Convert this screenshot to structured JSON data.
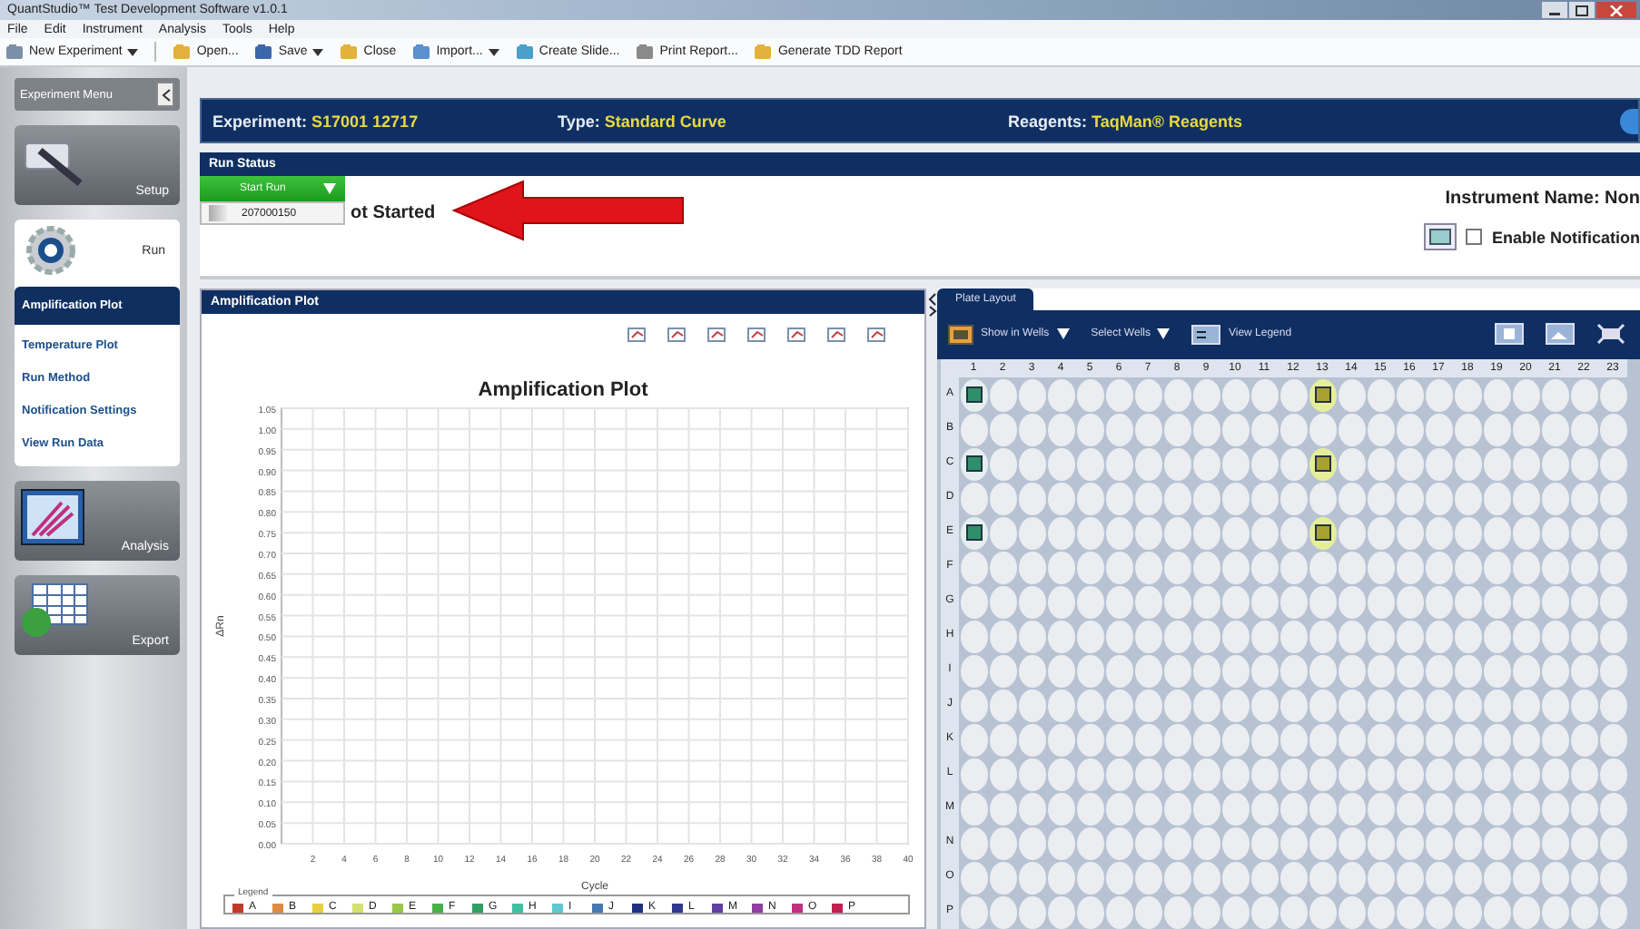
{
  "window": {
    "title": "QuantStudio™ Test Development Software v1.0.1"
  },
  "menu": [
    "File",
    "Edit",
    "Instrument",
    "Analysis",
    "Tools",
    "Help"
  ],
  "toolbar": [
    {
      "label": "New Experiment",
      "dropdown": true,
      "kind": "new"
    },
    {
      "label": "Open...",
      "dropdown": false,
      "kind": "folder"
    },
    {
      "label": "Save",
      "dropdown": true,
      "kind": "save"
    },
    {
      "label": "Close",
      "dropdown": false,
      "kind": "folder"
    },
    {
      "label": "Import...",
      "dropdown": true,
      "kind": "import"
    },
    {
      "label": "Create Slide...",
      "dropdown": false,
      "kind": "slide"
    },
    {
      "label": "Print Report...",
      "dropdown": false,
      "kind": "print"
    },
    {
      "label": "Generate TDD Report",
      "dropdown": false,
      "kind": "folder"
    }
  ],
  "sidebar": {
    "title": "Experiment Menu",
    "sections": [
      {
        "label": "Setup",
        "kind": "setup",
        "selected": false
      },
      {
        "label": "Run",
        "kind": "run",
        "selected": true,
        "children": [
          {
            "label": "Amplification Plot",
            "selected": true
          },
          {
            "label": "Temperature Plot",
            "selected": false
          },
          {
            "label": "Run Method",
            "selected": false
          },
          {
            "label": "Notification Settings",
            "selected": false
          },
          {
            "label": "View Run Data",
            "selected": false
          }
        ]
      },
      {
        "label": "Analysis",
        "kind": "analysis",
        "selected": false
      },
      {
        "label": "Export",
        "kind": "export",
        "selected": false
      }
    ]
  },
  "header": {
    "experiment_label": "Experiment:",
    "experiment": "S17001 12717",
    "type_label": "Type:",
    "type": "Standard Curve",
    "reagents_label": "Reagents:",
    "reagents": "TaqMan® Reagents"
  },
  "run": {
    "title": "Run Status",
    "start_button": "Start Run",
    "dropdown_item": "207000150",
    "status": "ot Started",
    "instrument": "Instrument Name: Non",
    "notification": {
      "label": "Enable Notification",
      "checked": false
    }
  },
  "amplification": {
    "title": "Amplification Plot",
    "chart_data": {
      "type": "line",
      "grid": true,
      "title": "Amplification Plot",
      "xlabel": "Cycle",
      "ylabel": "ΔRn",
      "xlim": [
        0,
        40
      ],
      "ylim": [
        0,
        1.05
      ],
      "xticks": [
        2,
        4,
        6,
        8,
        10,
        12,
        14,
        16,
        18,
        20,
        22,
        24,
        26,
        28,
        30,
        32,
        34,
        36,
        38,
        40
      ],
      "yticks": [
        {
          "value": 0,
          "label": "0.00"
        },
        {
          "value": 0.05,
          "label": "0.05"
        },
        {
          "value": 0.1,
          "label": "0.10"
        },
        {
          "value": 0.15,
          "label": "0.15"
        },
        {
          "value": 0.2,
          "label": "0.20"
        },
        {
          "value": 0.25,
          "label": "0.25"
        },
        {
          "value": 0.3,
          "label": "0.30"
        },
        {
          "value": 0.35,
          "label": "0.35"
        },
        {
          "value": 0.4,
          "label": "0.40"
        },
        {
          "value": 0.45,
          "label": "0.45"
        },
        {
          "value": 0.5,
          "label": "0.50"
        },
        {
          "value": 0.55,
          "label": "0.55"
        },
        {
          "value": 0.6,
          "label": "0.60"
        },
        {
          "value": 0.65,
          "label": "0.65"
        },
        {
          "value": 0.7,
          "label": "0.70"
        },
        {
          "value": 0.75,
          "label": "0.75"
        },
        {
          "value": 0.8,
          "label": "0.80"
        },
        {
          "value": 0.85,
          "label": "0.85"
        },
        {
          "value": 0.9,
          "label": "0.90"
        },
        {
          "value": 0.95,
          "label": "0.95"
        },
        {
          "value": 1,
          "label": "1.00"
        },
        {
          "value": 1.05,
          "label": "1.05"
        }
      ]
    },
    "legend": {
      "title": "Legend",
      "items": [
        {
          "label": "A",
          "color": "#c0392b"
        },
        {
          "label": "B",
          "color": "#e08a40"
        },
        {
          "label": "C",
          "color": "#e8d040"
        },
        {
          "label": "D",
          "color": "#d4e070"
        },
        {
          "label": "E",
          "color": "#98c848"
        },
        {
          "label": "F",
          "color": "#48b048"
        },
        {
          "label": "G",
          "color": "#30a060"
        },
        {
          "label": "H",
          "color": "#40c0a0"
        },
        {
          "label": "I",
          "color": "#60c8d0"
        },
        {
          "label": "J",
          "color": "#4878b0"
        },
        {
          "label": "K",
          "color": "#203080"
        },
        {
          "label": "L",
          "color": "#303890"
        },
        {
          "label": "M",
          "color": "#6040a0"
        },
        {
          "label": "N",
          "color": "#9040a0"
        },
        {
          "label": "O",
          "color": "#c03080"
        },
        {
          "label": "P",
          "color": "#c02050"
        }
      ]
    }
  },
  "plate": {
    "tab": "Plate Layout",
    "tools": [
      {
        "label": "Show in Wells",
        "kind": "menu"
      },
      {
        "label": "Select Wells",
        "kind": "menu"
      },
      {
        "label": "View Legend",
        "kind": "legend"
      }
    ],
    "columns": [
      "1",
      "2",
      "3",
      "4",
      "5",
      "6",
      "7",
      "8",
      "9",
      "10",
      "11",
      "12",
      "13",
      "14",
      "15",
      "16",
      "17",
      "18",
      "19",
      "20",
      "21",
      "22",
      "23"
    ],
    "rows": [
      {
        "label": "A",
        "wells": [
          {
            "kind": "standard"
          },
          {
            "kind": "empty"
          },
          {
            "kind": "empty"
          },
          {
            "kind": "empty"
          },
          {
            "kind": "empty"
          },
          {
            "kind": "empty"
          },
          {
            "kind": "empty"
          },
          {
            "kind": "empty"
          },
          {
            "kind": "empty"
          },
          {
            "kind": "empty"
          },
          {
            "kind": "empty"
          },
          {
            "kind": "empty"
          },
          {
            "kind": "unknown"
          },
          {
            "kind": "empty"
          },
          {
            "kind": "empty"
          },
          {
            "kind": "empty"
          },
          {
            "kind": "empty"
          },
          {
            "kind": "empty"
          },
          {
            "kind": "empty"
          },
          {
            "kind": "empty"
          },
          {
            "kind": "empty"
          },
          {
            "kind": "empty"
          },
          {
            "kind": "empty"
          }
        ]
      },
      {
        "label": "B"
      },
      {
        "label": "C",
        "wells": [
          {
            "kind": "standard"
          },
          {
            "kind": "empty"
          },
          {
            "kind": "empty"
          },
          {
            "kind": "empty"
          },
          {
            "kind": "empty"
          },
          {
            "kind": "empty"
          },
          {
            "kind": "empty"
          },
          {
            "kind": "empty"
          },
          {
            "kind": "empty"
          },
          {
            "kind": "empty"
          },
          {
            "kind": "empty"
          },
          {
            "kind": "empty"
          },
          {
            "kind": "unknown"
          },
          {
            "kind": "empty"
          },
          {
            "kind": "empty"
          },
          {
            "kind": "empty"
          },
          {
            "kind": "empty"
          },
          {
            "kind": "empty"
          },
          {
            "kind": "empty"
          },
          {
            "kind": "empty"
          },
          {
            "kind": "empty"
          },
          {
            "kind": "empty"
          },
          {
            "kind": "empty"
          }
        ]
      },
      {
        "label": "D"
      },
      {
        "label": "E",
        "wells": [
          {
            "kind": "standard"
          },
          {
            "kind": "empty"
          },
          {
            "kind": "empty"
          },
          {
            "kind": "empty"
          },
          {
            "kind": "empty"
          },
          {
            "kind": "empty"
          },
          {
            "kind": "empty"
          },
          {
            "kind": "empty"
          },
          {
            "kind": "empty"
          },
          {
            "kind": "empty"
          },
          {
            "kind": "empty"
          },
          {
            "kind": "empty"
          },
          {
            "kind": "unknown"
          },
          {
            "kind": "empty"
          },
          {
            "kind": "empty"
          },
          {
            "kind": "empty"
          },
          {
            "kind": "empty"
          },
          {
            "kind": "empty"
          },
          {
            "kind": "empty"
          },
          {
            "kind": "empty"
          },
          {
            "kind": "empty"
          },
          {
            "kind": "empty"
          },
          {
            "kind": "empty"
          }
        ]
      },
      {
        "label": "F"
      },
      {
        "label": "G"
      },
      {
        "label": "H"
      },
      {
        "label": "I"
      },
      {
        "label": "J"
      },
      {
        "label": "K"
      },
      {
        "label": "L"
      },
      {
        "label": "M"
      },
      {
        "label": "N"
      },
      {
        "label": "O"
      },
      {
        "label": "P"
      }
    ]
  }
}
